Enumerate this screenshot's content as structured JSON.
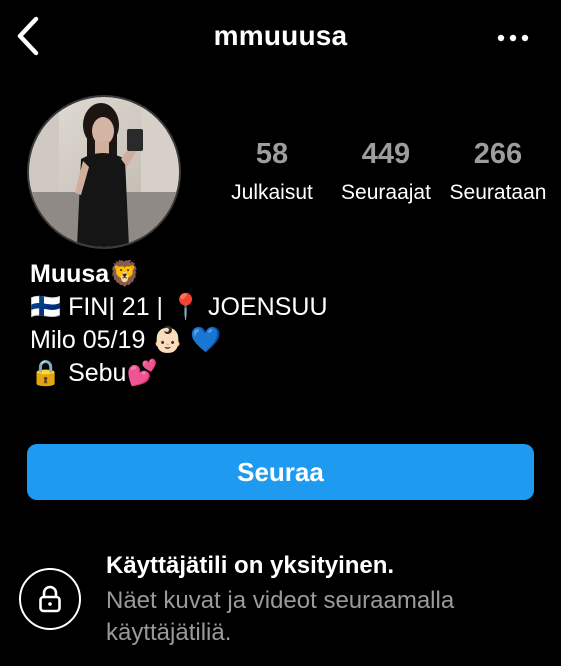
{
  "header": {
    "username": "mmuuusa",
    "back_icon": "chevron-left-icon",
    "more_icon": "more-horizontal-icon"
  },
  "stats": {
    "posts": {
      "value": "58",
      "label": "Julkaisut"
    },
    "followers": {
      "value": "449",
      "label": "Seuraajat"
    },
    "following": {
      "value": "266",
      "label": "Seurataan"
    }
  },
  "bio": {
    "name": "Muusa🦁",
    "line1": "🇫🇮 FIN| 21 | 📍 JOENSUU",
    "line2": "Milo 05/19 👶🏻 💙",
    "line3": "🔒 Sebu💕"
  },
  "follow_button": {
    "label": "Seuraa",
    "color": "#1e9bf0"
  },
  "private_notice": {
    "icon": "lock-icon",
    "title": "Käyttäjätili on yksityinen.",
    "subtitle": "Näet kuvat ja videot seuraamalla käyttäjätiliä."
  },
  "colors": {
    "background": "#000000",
    "text": "#ffffff",
    "muted": "#9a9a9a",
    "accent": "#1e9bf0"
  }
}
